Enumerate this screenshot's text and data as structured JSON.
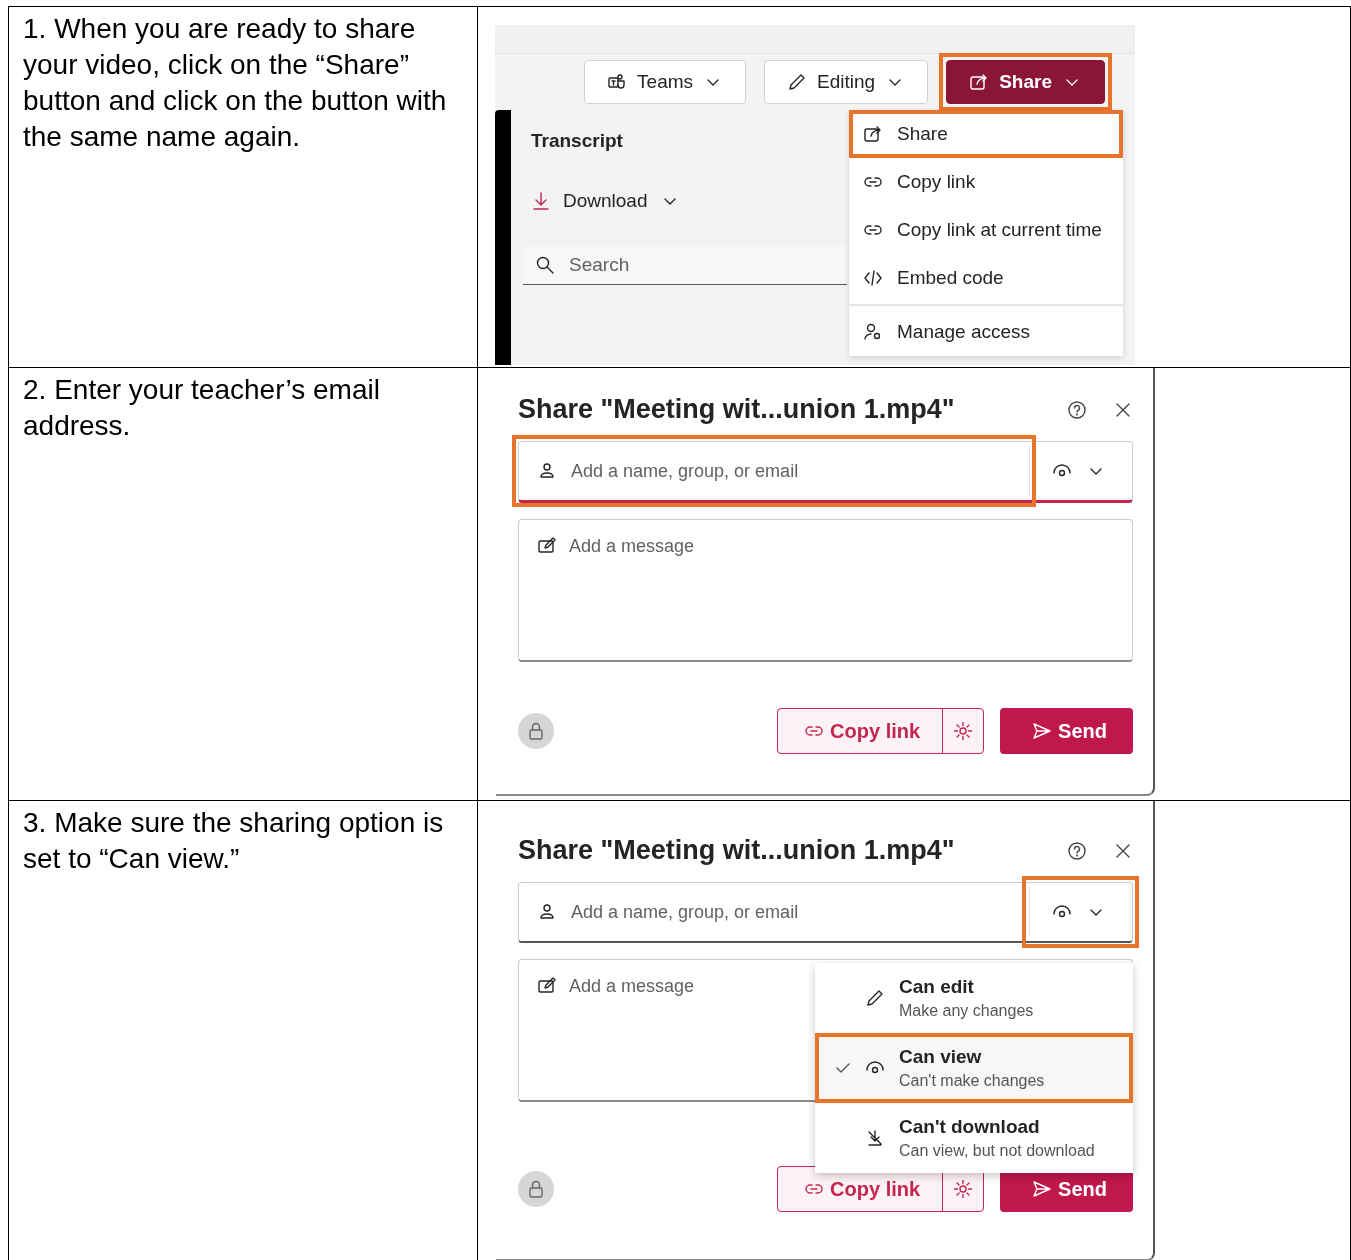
{
  "steps": [
    {
      "instruction": "1. When you are ready to share your video, click on the “Share” button and click on the button with the same name again.",
      "panel": {
        "kind": "share_menu",
        "toolbar": [
          {
            "kind": "teams",
            "label": "Teams",
            "highlighted": false
          },
          {
            "kind": "edit",
            "label": "Editing",
            "highlighted": false
          },
          {
            "kind": "share",
            "label": "Share",
            "highlighted": true
          }
        ],
        "transcript_title": "Transcript",
        "download": "Download",
        "search_placeholder": "Search",
        "menu": [
          {
            "label": "Share",
            "highlighted": true
          },
          {
            "label": "Copy link",
            "highlighted": false
          },
          {
            "label": "Copy link at current time",
            "highlighted": false
          },
          {
            "label": "Embed code",
            "highlighted": false
          },
          {
            "label": "Manage access",
            "highlighted": false
          }
        ]
      }
    },
    {
      "instruction": "2. Enter your teacher’s email address.",
      "panel": {
        "kind": "share_dialog",
        "title": "Share \"Meeting wit...union 1.mp4\"",
        "recipient_placeholder": "Add a name, group, or email",
        "recipient_highlighted": true,
        "permission_highlighted": false,
        "message_placeholder": "Add a message",
        "copy_link": "Copy link",
        "send": "Send"
      }
    },
    {
      "instruction": "3. Make sure the sharing option is set to “Can view.”",
      "panel": {
        "kind": "share_dialog",
        "title": "Share \"Meeting wit...union 1.mp4\"",
        "recipient_placeholder": "Add a name, group, or email",
        "recipient_highlighted": false,
        "permission_highlighted": true,
        "message_placeholder": "Add a message",
        "copy_link": "Copy link",
        "send": "Send",
        "permission_menu": [
          {
            "label": "Can edit",
            "description": "Make any changes",
            "selected": false,
            "highlighted": false
          },
          {
            "label": "Can view",
            "description": "Can't make changes",
            "selected": true,
            "highlighted": true
          },
          {
            "label": "Can't download",
            "description": "Can view, but not download",
            "selected": false,
            "highlighted": false
          }
        ]
      }
    }
  ]
}
